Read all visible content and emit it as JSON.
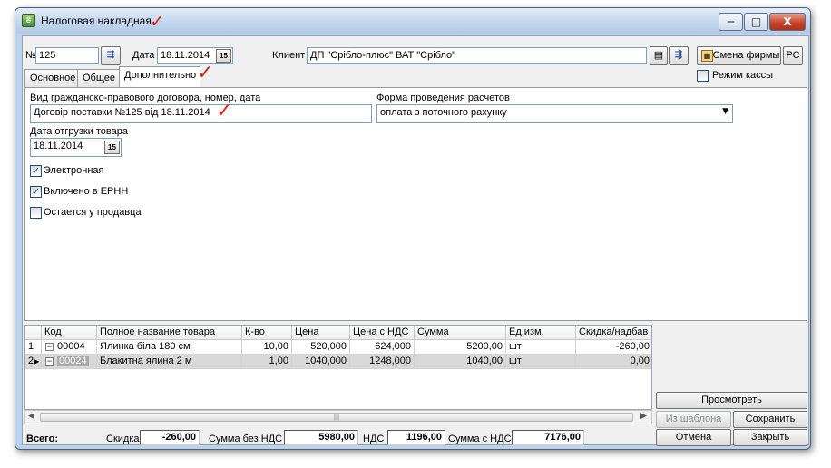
{
  "window": {
    "title": "Налоговая накладная",
    "minimize_glyph": "─",
    "maximize_glyph": "□",
    "close_glyph": "X"
  },
  "header": {
    "number_label": "№",
    "number_value": "125",
    "date_label": "Дата",
    "date_value": "18.11.2014",
    "client_label": "Клиент",
    "client_value": "ДП \"Срібло-плюс\" ВАТ \"Срібло\"",
    "change_firm_button": "Смена фирмы",
    "pc_button": "РС",
    "cash_mode_label": "Режим кассы",
    "cash_mode_checked": false
  },
  "tabs": [
    {
      "label": "Основное",
      "active": false
    },
    {
      "label": "Общее",
      "active": false
    },
    {
      "label": "Дополнительно",
      "active": true
    }
  ],
  "extra_tab": {
    "contract_label": "Вид гражданско-правового договора, номер, дата",
    "contract_value": "Договір поставки №125 від 18.11.2014",
    "payment_label": "Форма проведения расчетов",
    "payment_value": "оплата з поточного рахунку",
    "shipment_label": "Дата отгрузки товара",
    "shipment_value": "18.11.2014",
    "checkboxes": [
      {
        "label": "Электронная",
        "checked": true
      },
      {
        "label": "Включено в ЕРНН",
        "checked": true
      },
      {
        "label": "Остается у продавца",
        "checked": false
      }
    ]
  },
  "table": {
    "columns": [
      "Код",
      "Полное название товара",
      "К-во",
      "Цена",
      "Цена с НДС",
      "Сумма",
      "Ед.изм.",
      "Скидка/надбав"
    ],
    "rows": [
      {
        "num": "1",
        "code": "00004",
        "name": "Ялинка біла 180 см",
        "qty": "10,00",
        "price": "520,000",
        "price_vat": "624,000",
        "sum": "5200,00",
        "unit": "шт",
        "discount": "-260,00"
      },
      {
        "num": "2",
        "code": "00024",
        "name": "Блакитна ялина 2 м",
        "qty": "1,00",
        "price": "1040,000",
        "price_vat": "1248,000",
        "sum": "1040,00",
        "unit": "шт",
        "discount": "0,00"
      }
    ]
  },
  "totals": {
    "total_label": "Всего:",
    "discount_label": "Скидка",
    "discount_value": "-260,00",
    "sum_no_vat_label": "Сумма без НДС",
    "sum_no_vat_value": "5980,00",
    "vat_label": "НДС",
    "vat_value": "1196,00",
    "sum_vat_label": "Сумма с НДС",
    "sum_vat_value": "7176,00"
  },
  "buttons": {
    "preview": "Просмотреть",
    "from_template": "Из шаблона",
    "save": "Сохранить",
    "cancel": "Отмена",
    "close": "Закрыть"
  },
  "annotation": {
    "check_mark": "✓",
    "color": "#e0241b"
  }
}
